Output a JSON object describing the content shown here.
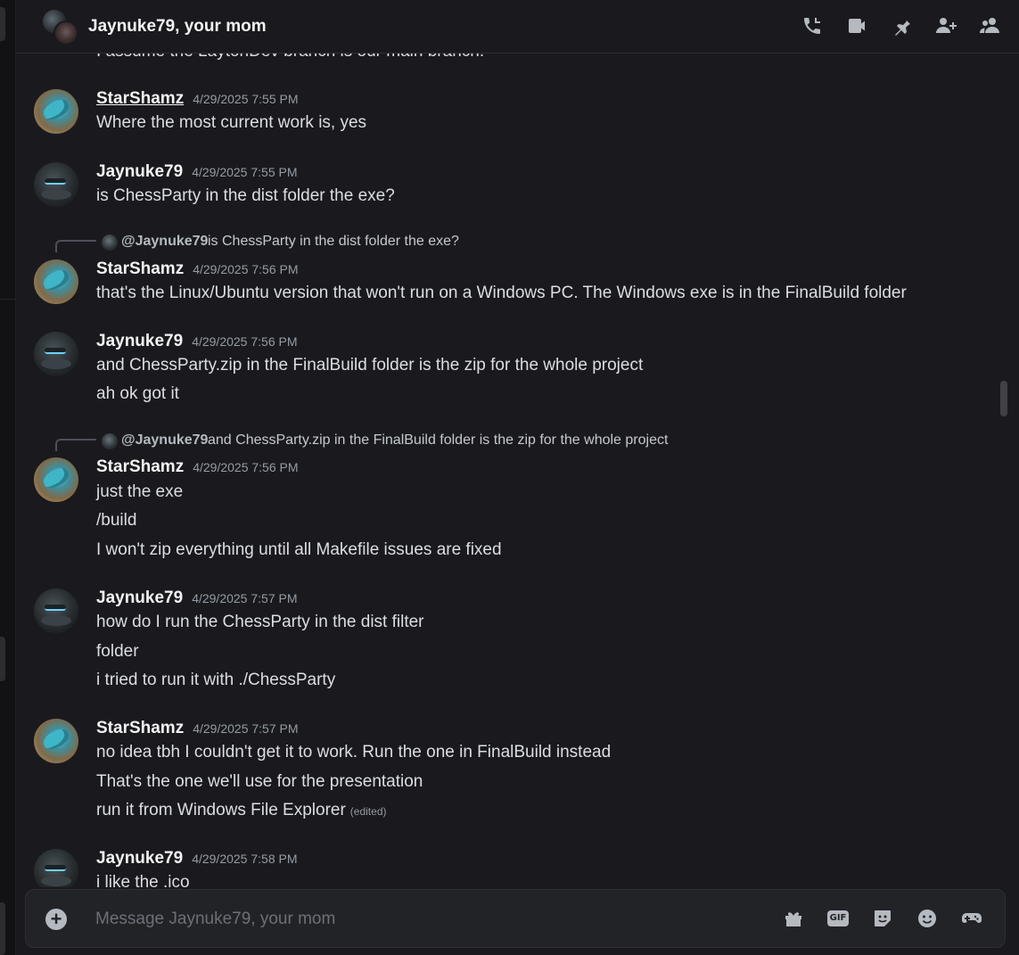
{
  "header": {
    "title": "Jaynuke79, your mom",
    "icons": [
      "phone-call-icon",
      "video-camera-icon",
      "pin-icon",
      "add-friend-icon",
      "members-icon"
    ]
  },
  "chat": {
    "top_cut_text": "I assume the LaytonDev branch is our main branch.",
    "messages": [
      {
        "author": "StarShamz",
        "timestamp": "4/29/2025 7:55 PM",
        "lines": [
          "Where the most current work is, yes"
        ]
      },
      {
        "author": "Jaynuke79",
        "timestamp": "4/29/2025 7:55 PM",
        "lines": [
          "is ChessParty in the dist folder the exe?"
        ]
      },
      {
        "reply": {
          "mention": "@Jaynuke79",
          "text": "is ChessParty in the dist folder the exe?"
        },
        "author": "StarShamz",
        "timestamp": "4/29/2025 7:56 PM",
        "lines": [
          "that's the Linux/Ubuntu version that won't run on a Windows PC. The Windows exe is in the FinalBuild folder"
        ]
      },
      {
        "author": "Jaynuke79",
        "timestamp": "4/29/2025 7:56 PM",
        "lines": [
          "and ChessParty.zip in the FinalBuild folder is the zip for the whole project",
          "ah ok got it"
        ]
      },
      {
        "reply": {
          "mention": "@Jaynuke79",
          "text": "and ChessParty.zip in the FinalBuild folder is the zip for the whole project"
        },
        "author": "StarShamz",
        "timestamp": "4/29/2025 7:56 PM",
        "lines": [
          "just the exe",
          "/build",
          "I won't zip everything until all Makefile issues are fixed"
        ]
      },
      {
        "author": "Jaynuke79",
        "timestamp": "4/29/2025 7:57 PM",
        "lines": [
          "how do I run the ChessParty in the dist filter",
          "folder",
          "i tried to run it with ./ChessParty"
        ]
      },
      {
        "author": "StarShamz",
        "timestamp": "4/29/2025 7:57 PM",
        "lines": [
          "no idea tbh I couldn't get it to work. Run the one in FinalBuild instead",
          "That's the one we'll use for the presentation",
          "run it from Windows File Explorer"
        ],
        "edited_label": "(edited)"
      },
      {
        "author": "Jaynuke79",
        "timestamp": "4/29/2025 7:58 PM",
        "lines": [
          "i like the .ico"
        ]
      }
    ]
  },
  "composer": {
    "placeholder": "Message Jaynuke79, your mom",
    "gif_label": "GIF",
    "icons": [
      "plus-icon",
      "gift-icon",
      "gif-icon",
      "sticker-icon",
      "emoji-icon",
      "gamepad-icon"
    ]
  }
}
